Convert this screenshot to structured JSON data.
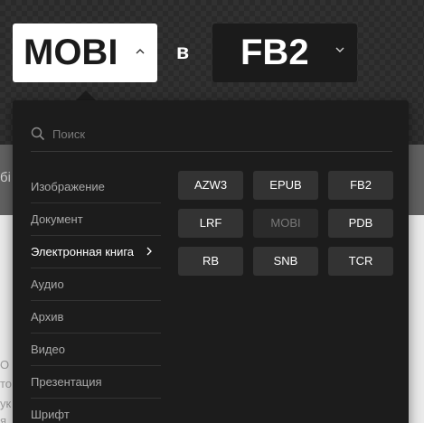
{
  "converter": {
    "from_value": "MOBI",
    "separator": "в",
    "to_value": "FB2"
  },
  "dropdown": {
    "search_placeholder": "Поиск",
    "categories": [
      {
        "label": "Изображение",
        "active": false
      },
      {
        "label": "Документ",
        "active": false
      },
      {
        "label": "Электронная книга",
        "active": true
      },
      {
        "label": "Аудио",
        "active": false
      },
      {
        "label": "Архив",
        "active": false
      },
      {
        "label": "Видео",
        "active": false
      },
      {
        "label": "Презентация",
        "active": false
      },
      {
        "label": "Шрифт",
        "active": false
      }
    ],
    "formats": [
      {
        "label": "AZW3",
        "disabled": false
      },
      {
        "label": "EPUB",
        "disabled": false
      },
      {
        "label": "FB2",
        "disabled": false
      },
      {
        "label": "LRF",
        "disabled": false
      },
      {
        "label": "MOBI",
        "disabled": true
      },
      {
        "label": "PDB",
        "disabled": false
      },
      {
        "label": "RB",
        "disabled": false
      },
      {
        "label": "SNB",
        "disabled": false
      },
      {
        "label": "TCR",
        "disabled": false
      }
    ]
  },
  "background": {
    "fragments": [
      "бі",
      "О",
      "то",
      "ук",
      "я"
    ]
  },
  "colors": {
    "panel": "#1c1c1c",
    "format_button": "#333333",
    "header_bg": "#2a2a2a",
    "band_bg": "#616161"
  },
  "icons": {
    "search": "search-icon",
    "chevron": "chevron-down-icon",
    "submenu": "chevron-right-icon"
  }
}
